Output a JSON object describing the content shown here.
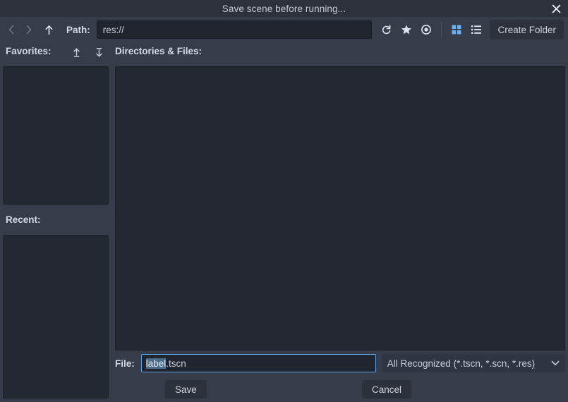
{
  "window": {
    "title": "Save scene before running...",
    "close_icon": "close-icon"
  },
  "toolbar": {
    "back_icon": "chevron-left-icon",
    "forward_icon": "chevron-right-icon",
    "up_icon": "arrow-up-icon",
    "path_label": "Path:",
    "path_value": "res://",
    "path_placeholder": "res://",
    "refresh_icon": "refresh-icon",
    "favorite_icon": "star-icon",
    "show_hidden_icon": "eye-icon",
    "grid_view_icon": "grid-view-icon",
    "list_view_icon": "list-view-icon",
    "create_folder_label": "Create Folder",
    "active_view": "grid",
    "accent_color": "#6ab0f3"
  },
  "sidebar": {
    "favorites_label": "Favorites:",
    "favorites_move_up_icon": "move-up-icon",
    "favorites_move_down_icon": "move-down-icon",
    "favorites_items": [],
    "recent_label": "Recent:",
    "recent_items": []
  },
  "main": {
    "directories_label": "Directories & Files:",
    "entries": []
  },
  "file_row": {
    "label": "File:",
    "value": "label.tscn",
    "selected_text": "label",
    "unselected_text": ".tscn",
    "filter_value": "All Recognized (*.tscn, *.scn, *.res)",
    "filter_chevron_icon": "chevron-down-icon",
    "focus_color": "#5aa5e8",
    "selection_color": "#4a6b8a"
  },
  "actions": {
    "save_label": "Save",
    "cancel_label": "Cancel"
  },
  "theme": {
    "dialog_background": "#363c4a",
    "titlebar_background": "#2c313c",
    "panel_background": "#242830",
    "input_background": "#21252e",
    "text_color": "#cdd3de"
  }
}
